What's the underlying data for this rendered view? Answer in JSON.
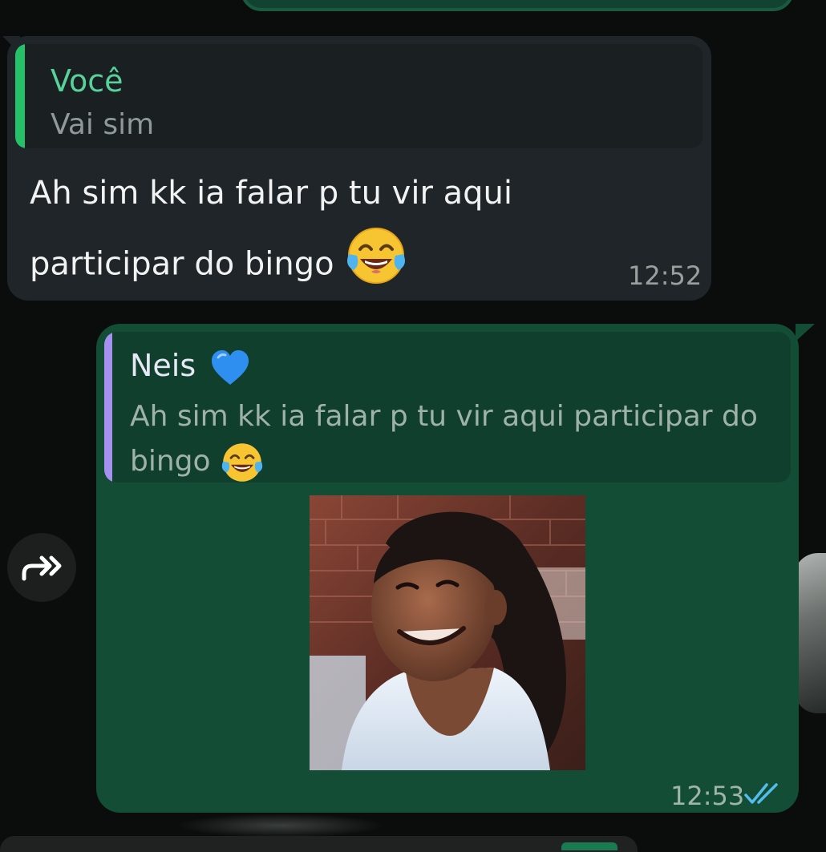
{
  "incoming": {
    "quote_author": "Você",
    "quote_text": "Vai sim",
    "message": "Ah sim kk ia falar p tu vir aqui participar do bingo",
    "emoji": "face-with-tears-of-joy-icon",
    "time": "12:52"
  },
  "outgoing": {
    "quote_author": "Neis",
    "quote_author_emoji": "blue-heart-icon",
    "quote_text": "Ah sim kk ia falar p tu vir aqui participar do bingo",
    "photo": "girl-smiling-photo",
    "time": "12:53",
    "status": "read-double-check-icon"
  },
  "colors": {
    "incoming_bubble": "#1f2528",
    "outgoing_bubble": "#134d36",
    "quote_accent_green": "#25c067",
    "quote_accent_purple": "#a591f0",
    "read_ticks": "#53bdeb"
  }
}
